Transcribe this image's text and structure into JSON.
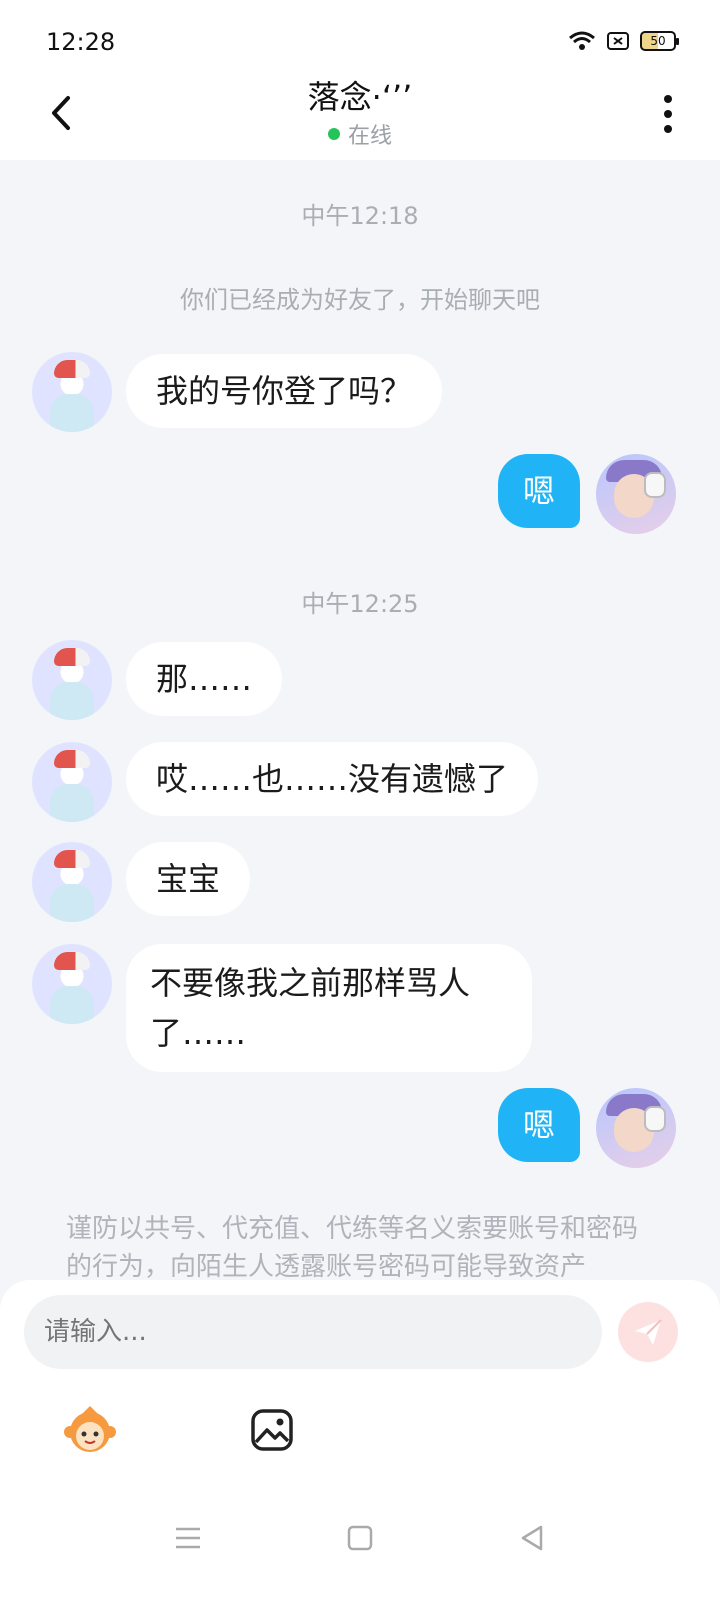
{
  "status_bar": {
    "time": "12:28",
    "battery_level": "50",
    "icons": [
      "wifi-icon",
      "sim-off-icon",
      "battery-icon"
    ]
  },
  "header": {
    "title": "落念·‘’’",
    "status_text": "在线",
    "status_color": "#24c45b"
  },
  "chat": {
    "time_1": "中午12:18",
    "system_text": "你们已经成为好友了，开始聊天吧",
    "time_2": "中午12:25",
    "messages": [
      {
        "from": "other",
        "text": "我的号你登了吗？"
      },
      {
        "from": "me",
        "text": "嗯"
      },
      {
        "from": "other",
        "text": "那……"
      },
      {
        "from": "other",
        "text": "哎……也……没有遗憾了"
      },
      {
        "from": "other",
        "text": "宝宝"
      },
      {
        "from": "other",
        "text": "不要像我之前那样骂人了……"
      },
      {
        "from": "me",
        "text": "嗯"
      }
    ],
    "notice": "谨防以共号、代充值、代练等名义索要账号和密码的行为，向陌生人透露账号密码可能导致资产"
  },
  "input": {
    "placeholder": "请输入...",
    "send_icon": "send-icon",
    "tools": [
      "emoji-mascot-icon",
      "image-icon"
    ]
  },
  "nav": {
    "buttons": [
      "menu-icon",
      "home-icon",
      "back-icon"
    ]
  },
  "colors": {
    "accent_blue": "#20b4f6",
    "background": "#f3f5f8",
    "online_green": "#24c45b"
  }
}
